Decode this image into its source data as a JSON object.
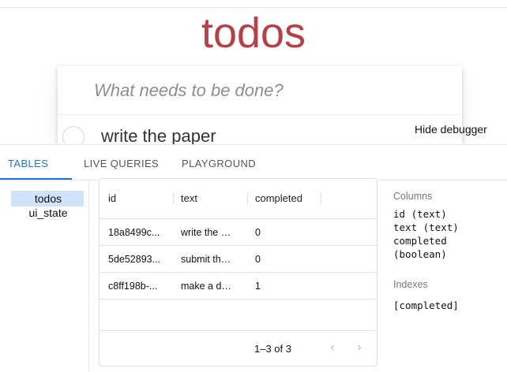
{
  "app": {
    "title": "todos",
    "new_todo_placeholder": "What needs to be done?",
    "todos": [
      {
        "text": "write the paper",
        "completed": false
      }
    ]
  },
  "debugger_toggle": "Hide debugger",
  "debugger": {
    "tabs": [
      {
        "label": "TABLES",
        "active": true
      },
      {
        "label": "LIVE QUERIES",
        "active": false
      },
      {
        "label": "PLAYGROUND",
        "active": false
      }
    ],
    "tables": [
      {
        "name": "todos",
        "selected": true
      },
      {
        "name": "ui_state",
        "selected": false
      }
    ],
    "grid": {
      "columns": [
        "id",
        "text",
        "completed"
      ],
      "rows": [
        [
          "18a8499c...",
          "write the …",
          "0"
        ],
        [
          "5de52893...",
          "submit th…",
          "0"
        ],
        [
          "c8ff198b-...",
          "make a d…",
          "1"
        ]
      ],
      "pagination": "1–3 of 3",
      "prev_icon": "chevron-left",
      "next_icon": "chevron-right"
    },
    "schema": {
      "columns_heading": "Columns",
      "columns": [
        "id (text)",
        "text (text)",
        "completed",
        "(boolean)"
      ],
      "indexes_heading": "Indexes",
      "indexes": [
        "[completed]"
      ]
    }
  },
  "colors": {
    "title": "#b83f45",
    "accent": "#1976d2",
    "selected_bg": "#cfe3fb"
  }
}
